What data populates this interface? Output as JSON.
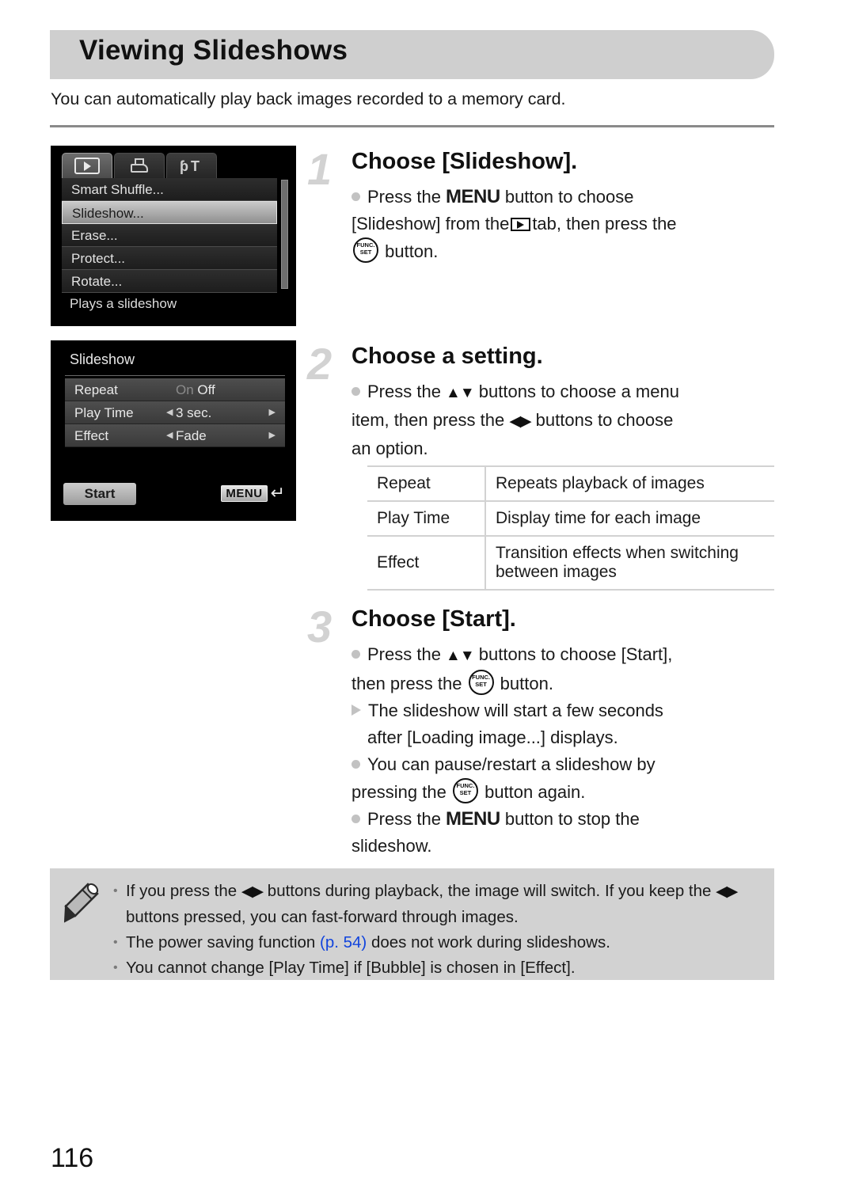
{
  "page": {
    "title": "Viewing Slideshows",
    "intro": "You can automatically play back images recorded to a memory card.",
    "number": "116"
  },
  "camera_screen_1": {
    "tabs": [
      {
        "icon": "playback-tab-icon",
        "active": true
      },
      {
        "icon": "print-tab-icon",
        "active": false
      },
      {
        "icon": "settings-tab-icon",
        "active": false
      }
    ],
    "menu_items": [
      {
        "label": "Smart Shuffle...",
        "selected": false
      },
      {
        "label": "Slideshow...",
        "selected": true
      },
      {
        "label": "Erase...",
        "selected": false
      },
      {
        "label": "Protect...",
        "selected": false
      },
      {
        "label": "Rotate...",
        "selected": false
      }
    ],
    "hint": "Plays a slideshow"
  },
  "camera_screen_2": {
    "title": "Slideshow",
    "rows": [
      {
        "label": "Repeat",
        "option_off": "On",
        "option_on": "Off",
        "arrows": false
      },
      {
        "label": "Play Time",
        "value": "3 sec.",
        "arrows": true
      },
      {
        "label": "Effect",
        "value": "Fade",
        "arrows": true
      }
    ],
    "start_button": "Start",
    "menu_chip": "MENU"
  },
  "steps": [
    {
      "number": "1",
      "title": "Choose [Slideshow].",
      "lines": [
        {
          "marker": "dot",
          "parts": [
            {
              "t": "text",
              "v": "Press the "
            },
            {
              "t": "icon",
              "v": "MENU"
            },
            {
              "t": "text",
              "v": " button to choose"
            }
          ]
        },
        {
          "marker": "none",
          "parts": [
            {
              "t": "text",
              "v": "[Slideshow] from the "
            },
            {
              "t": "icon",
              "v": "PLAY_TAB"
            },
            {
              "t": "text",
              "v": " tab, then press the"
            }
          ]
        },
        {
          "marker": "none",
          "parts": [
            {
              "t": "icon",
              "v": "FUNC_SET"
            },
            {
              "t": "text",
              "v": " button."
            }
          ]
        }
      ]
    },
    {
      "number": "2",
      "title": "Choose a setting.",
      "lines": [
        {
          "marker": "dot",
          "parts": [
            {
              "t": "text",
              "v": "Press the "
            },
            {
              "t": "icon",
              "v": "UP_DOWN"
            },
            {
              "t": "text",
              "v": " buttons to choose a menu"
            }
          ]
        },
        {
          "marker": "none",
          "parts": [
            {
              "t": "text",
              "v": "item, then press the "
            },
            {
              "t": "icon",
              "v": "LEFT_RIGHT"
            },
            {
              "t": "text",
              "v": " buttons to choose"
            }
          ]
        },
        {
          "marker": "none",
          "parts": [
            {
              "t": "text",
              "v": "an option."
            }
          ]
        }
      ]
    },
    {
      "number": "3",
      "title": "Choose [Start].",
      "lines": [
        {
          "marker": "dot",
          "parts": [
            {
              "t": "text",
              "v": "Press the "
            },
            {
              "t": "icon",
              "v": "UP_DOWN"
            },
            {
              "t": "text",
              "v": " buttons to choose [Start],"
            }
          ]
        },
        {
          "marker": "none",
          "parts": [
            {
              "t": "text",
              "v": "then press the "
            },
            {
              "t": "icon",
              "v": "FUNC_SET"
            },
            {
              "t": "text",
              "v": " button."
            }
          ]
        },
        {
          "marker": "triangle",
          "parts": [
            {
              "t": "text",
              "v": "The slideshow will start a few seconds"
            }
          ]
        },
        {
          "marker": "none",
          "parts": [
            {
              "t": "text",
              "v": "after [Loading image...] displays."
            }
          ]
        },
        {
          "marker": "dot",
          "parts": [
            {
              "t": "text",
              "v": "You can pause/restart a slideshow by"
            }
          ]
        },
        {
          "marker": "none",
          "parts": [
            {
              "t": "text",
              "v": "pressing the "
            },
            {
              "t": "icon",
              "v": "FUNC_SET"
            },
            {
              "t": "text",
              "v": " button again."
            }
          ]
        },
        {
          "marker": "dot",
          "parts": [
            {
              "t": "text",
              "v": "Press the "
            },
            {
              "t": "icon",
              "v": "MENU"
            },
            {
              "t": "text",
              "v": " button to stop the"
            }
          ]
        },
        {
          "marker": "none",
          "parts": [
            {
              "t": "text",
              "v": "slideshow."
            }
          ]
        }
      ]
    }
  ],
  "settings_table": {
    "rows": [
      {
        "key": "Repeat",
        "desc": "Repeats playback of images"
      },
      {
        "key": "Play Time",
        "desc": "Display time for each image"
      },
      {
        "key": "Effect",
        "desc": "Transition effects when switching between images"
      }
    ]
  },
  "note_box": {
    "icon": "pencil-icon",
    "items": [
      {
        "parts": [
          {
            "t": "text",
            "v": "If you press the "
          },
          {
            "t": "icon",
            "v": "LEFT_RIGHT"
          },
          {
            "t": "text",
            "v": " buttons during playback, the image will switch. If you keep the "
          },
          {
            "t": "icon",
            "v": "LEFT_RIGHT"
          },
          {
            "t": "text",
            "v": " buttons pressed, you can fast-forward through images."
          }
        ]
      },
      {
        "parts": [
          {
            "t": "text",
            "v": "The power saving function "
          },
          {
            "t": "link",
            "v": "(p. 54)"
          },
          {
            "t": "text",
            "v": " does not work during slideshows."
          }
        ]
      },
      {
        "parts": [
          {
            "t": "text",
            "v": "You cannot change [Play Time] if [Bubble] is chosen in [Effect]."
          }
        ]
      }
    ]
  },
  "colors": {
    "header_band": "#cfcfcf",
    "note_box_bg": "#d2d2d2",
    "step_number": "#d2d2d2",
    "link": "#1144dd",
    "rule": "#8a8a8a"
  }
}
